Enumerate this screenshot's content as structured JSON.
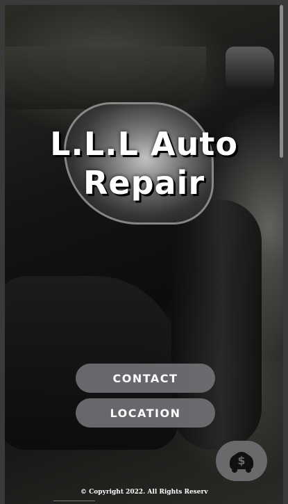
{
  "site": {
    "title": "L.L.L Auto Repair"
  },
  "nav": {
    "contact_label": "CONTACT",
    "location_label": "LOCATION"
  },
  "pay_button": {
    "icon": "dollar-icon"
  },
  "footer": {
    "copyright": "© Copyright 2022. All Rights Reserv"
  },
  "colors": {
    "button_bg": "#78787C",
    "fab_bg": "#6A6A6C",
    "title_text": "#FFFFFF"
  }
}
